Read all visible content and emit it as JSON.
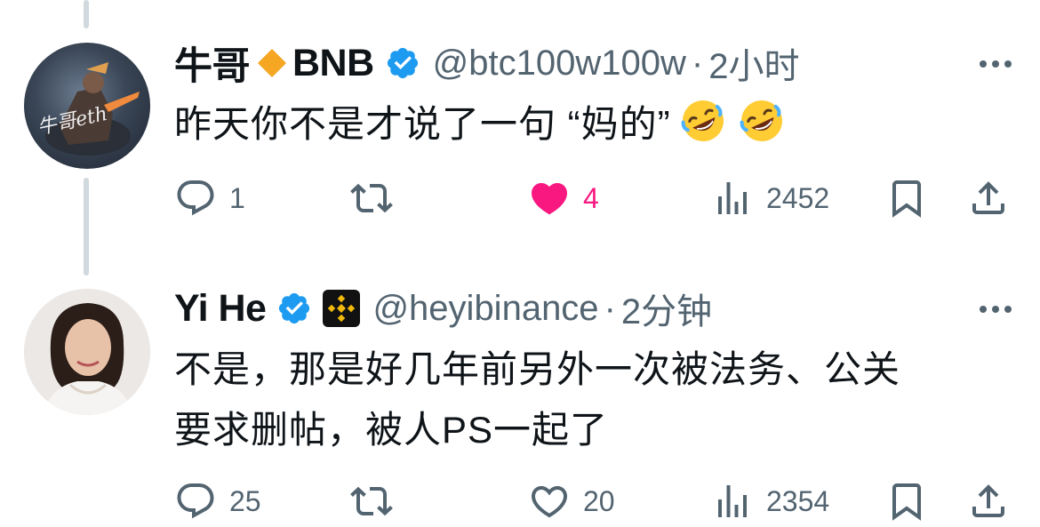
{
  "colors": {
    "text": "#0f1419",
    "secondary": "#536471",
    "verified": "#1d9bf0",
    "like": "#f91880",
    "thread_line": "#cfd9de"
  },
  "tweets": [
    {
      "name": "牛哥",
      "name_suffix": "BNB",
      "avatar_text": "牛哥eth",
      "handle": "@btc100w100w",
      "separator": "·",
      "time": "2小时",
      "text_prefix": "昨天你不是才说了一句 “妈的”",
      "emoji": "rolling-on-floor-laughing",
      "actions": {
        "reply_count": "1",
        "retweet_count": "",
        "like_count": "4",
        "liked": true,
        "view_count": "2452"
      }
    },
    {
      "name": "Yi He",
      "handle": "@heyibinance",
      "separator": "·",
      "time": "2分钟",
      "text_line1": "不是，那是好几年前另外一次被法务、公关",
      "text_line2": "要求删帖，被人PS一起了",
      "actions": {
        "reply_count": "25",
        "retweet_count": "",
        "like_count": "20",
        "liked": false,
        "view_count": "2354"
      }
    }
  ],
  "icons": [
    "reply-icon",
    "retweet-icon",
    "like-icon",
    "views-icon",
    "bookmark-icon",
    "share-icon",
    "verified-badge-icon",
    "more-icon"
  ]
}
